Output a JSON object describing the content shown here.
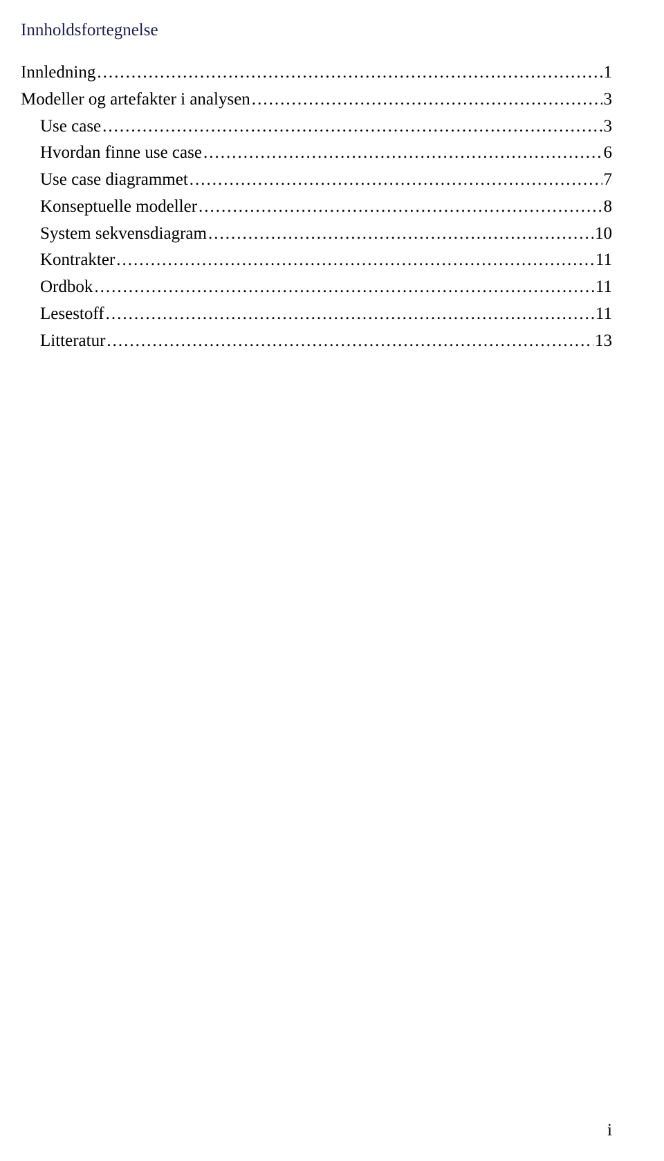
{
  "toc": {
    "title": "Innholdsfortegnelse",
    "entries": [
      {
        "label": "Innledning",
        "page": "1",
        "indent": 0
      },
      {
        "label": "Modeller og artefakter i analysen",
        "page": "3",
        "indent": 0
      },
      {
        "label": "Use case",
        "page": "3",
        "indent": 1
      },
      {
        "label": "Hvordan finne use case",
        "page": "6",
        "indent": 1
      },
      {
        "label": "Use case diagrammet",
        "page": "7",
        "indent": 1
      },
      {
        "label": "Konseptuelle modeller",
        "page": "8",
        "indent": 1
      },
      {
        "label": "System sekvensdiagram",
        "page": "10",
        "indent": 1
      },
      {
        "label": "Kontrakter",
        "page": "11",
        "indent": 1
      },
      {
        "label": "Ordbok",
        "page": "11",
        "indent": 1
      },
      {
        "label": "Lesestoff",
        "page": "11",
        "indent": 1
      },
      {
        "label": "Litteratur",
        "page": "13",
        "indent": 1
      }
    ]
  },
  "page_number": "i"
}
